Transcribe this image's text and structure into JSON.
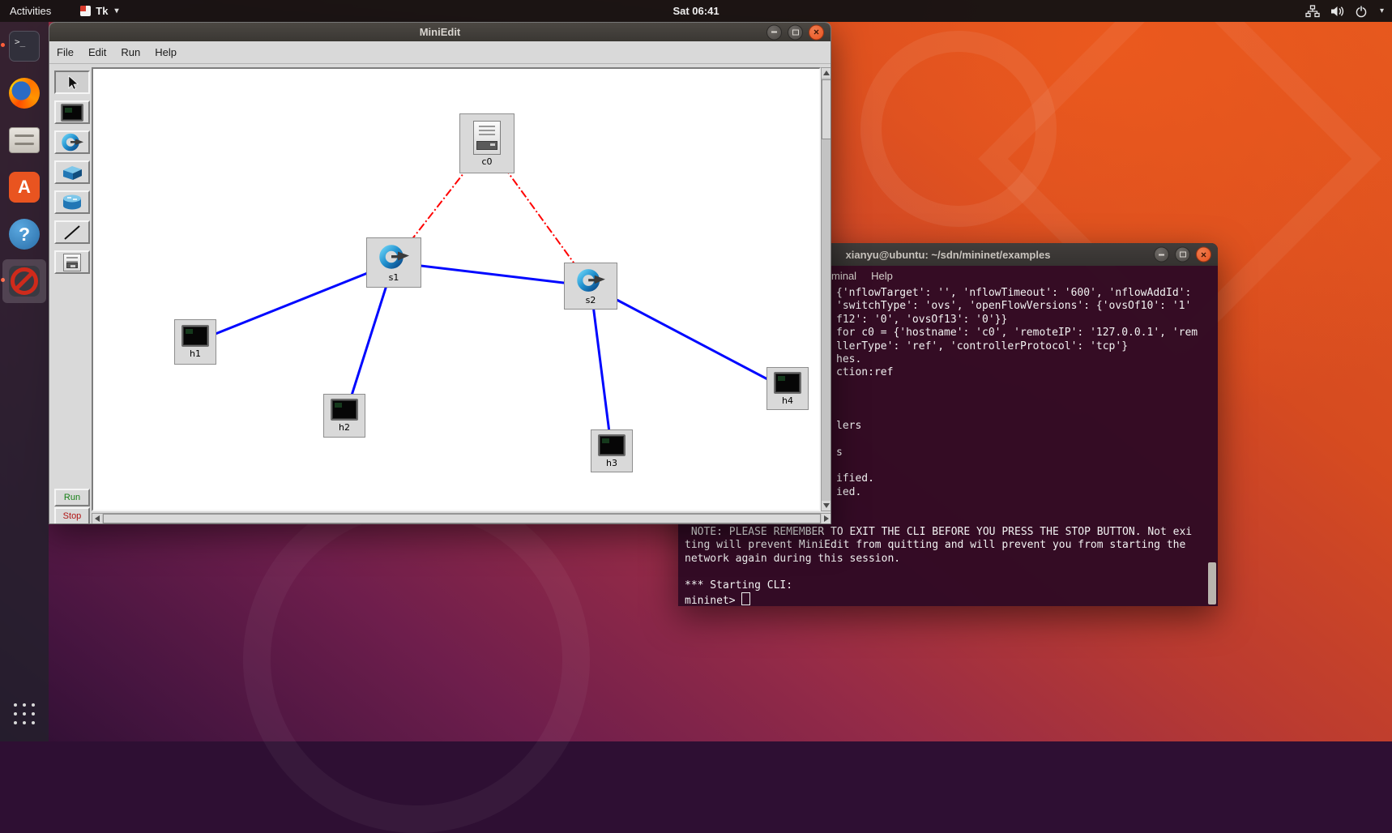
{
  "topbar": {
    "activities": "Activities",
    "app": "Tk",
    "clock": "Sat 06:41"
  },
  "dock": {
    "items": [
      "terminal",
      "firefox",
      "files",
      "ubuntu-software",
      "help",
      "miniedit-running"
    ]
  },
  "miniedit": {
    "title": "MiniEdit",
    "menus": [
      "File",
      "Edit",
      "Run",
      "Help"
    ],
    "run": "Run",
    "stop": "Stop",
    "nodes": [
      {
        "id": "c0",
        "type": "controller",
        "label": "c0"
      },
      {
        "id": "s1",
        "type": "switch",
        "label": "s1"
      },
      {
        "id": "s2",
        "type": "switch",
        "label": "s2"
      },
      {
        "id": "h1",
        "type": "host",
        "label": "h1"
      },
      {
        "id": "h2",
        "type": "host",
        "label": "h2"
      },
      {
        "id": "h3",
        "type": "host",
        "label": "h3"
      },
      {
        "id": "h4",
        "type": "host",
        "label": "h4"
      }
    ],
    "links": {
      "controller_links": [
        "c0-s1",
        "c0-s2"
      ],
      "data_links": [
        "s1-s2",
        "s1-h1",
        "s1-h2",
        "s2-h3",
        "s2-h4"
      ],
      "controller_style": "red-dash-dot",
      "data_style": "blue-solid"
    }
  },
  "terminal": {
    "title": "xianyu@ubuntu: ~/sdn/mininet/examples",
    "menu": [
      "minal",
      "Help"
    ],
    "lines": [
      "{'nflowTarget': '', 'nflowTimeout': '600', 'nflowAddId':",
      "'switchType': 'ovs', 'openFlowVersions': {'ovsOf10': '1'",
      "f12': '0', 'ovsOf13': '0'}}",
      "for c0 = {'hostname': 'c0', 'remoteIP': '127.0.0.1', 'rem",
      "llerType': 'ref', 'controllerProtocol': 'tcp'}",
      "hes.",
      "ction:ref",
      "",
      "",
      "",
      "lers",
      "",
      "s",
      "",
      "ified.",
      "ied.",
      "",
      "",
      " NOTE: PLEASE REMEMBER TO EXIT THE CLI BEFORE YOU PRESS THE STOP BUTTON. Not exi",
      "ting will prevent MiniEdit from quitting and will prevent you from starting the",
      "network again during this session.",
      "",
      "*** Starting CLI:",
      "mininet> "
    ]
  },
  "colors": {
    "accent": "#e95420",
    "terminal_bg": "#300a24",
    "data_link": "#0008ff",
    "controller_link": "#ff0000"
  }
}
